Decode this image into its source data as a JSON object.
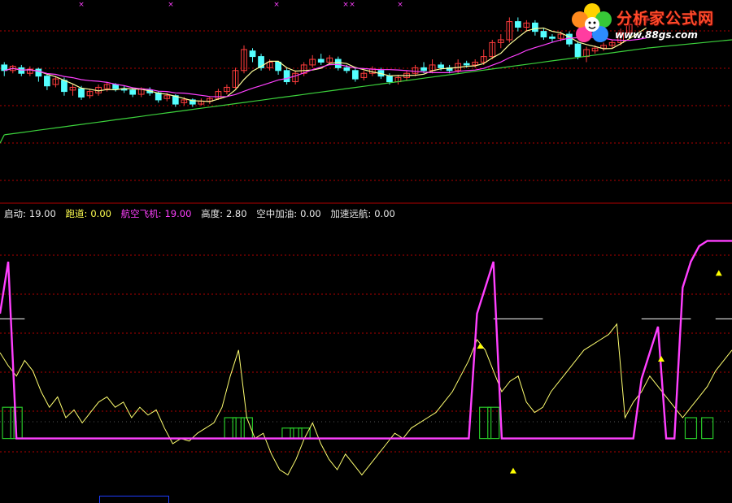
{
  "logo": {
    "title": "分析家公式网",
    "url": "www.88gs.com"
  },
  "indicator_readout": [
    {
      "label": "启动:",
      "value": "19.00",
      "label_color": "#e8e8e8",
      "value_color": "#e8e8e8"
    },
    {
      "label": "跑道:",
      "value": "0.00",
      "label_color": "#ffff50",
      "value_color": "#ffff50"
    },
    {
      "label": "航空飞机:",
      "value": "19.00",
      "label_color": "#ff40ff",
      "value_color": "#ff40ff"
    },
    {
      "label": "高度:",
      "value": "2.80",
      "label_color": "#e8e8e8",
      "value_color": "#e8e8e8"
    },
    {
      "label": "空中加油:",
      "value": "0.00",
      "label_color": "#e8e8e8",
      "value_color": "#e8e8e8"
    },
    {
      "label": "加速远航:",
      "value": "0.00",
      "label_color": "#e8e8e8",
      "value_color": "#e8e8e8"
    }
  ],
  "colors": {
    "background": "#000000",
    "grid": "#b00000",
    "up_candle": "#ff3c3c",
    "down_candle": "#54ffff",
    "ma_short": "#ffff9a",
    "ma_mid": "#ff40ff",
    "ma_long": "#3cd23c",
    "oscillator": "#ffff70",
    "runway": "#ff40ff",
    "bars": "#28c828",
    "marker": "#ffff00",
    "white_level": "#ffffff",
    "top_marks": "#ff40ff"
  },
  "chart_data": [
    {
      "type": "candlestick",
      "panel": "price",
      "y_range": [
        0,
        100
      ],
      "grid": true,
      "candles": [
        {
          "o": 64,
          "c": 60,
          "h": 66,
          "l": 56
        },
        {
          "o": 60,
          "c": 63,
          "h": 64,
          "l": 58
        },
        {
          "o": 62,
          "c": 58,
          "h": 64,
          "l": 56
        },
        {
          "o": 58,
          "c": 61,
          "h": 63,
          "l": 56
        },
        {
          "o": 61,
          "c": 56,
          "h": 62,
          "l": 52
        },
        {
          "o": 56,
          "c": 49,
          "h": 57,
          "l": 46
        },
        {
          "o": 50,
          "c": 54,
          "h": 56,
          "l": 48
        },
        {
          "o": 53,
          "c": 45,
          "h": 55,
          "l": 42
        },
        {
          "o": 46,
          "c": 48,
          "h": 50,
          "l": 42
        },
        {
          "o": 47,
          "c": 41,
          "h": 49,
          "l": 39
        },
        {
          "o": 42,
          "c": 45,
          "h": 47,
          "l": 40
        },
        {
          "o": 44,
          "c": 48,
          "h": 50,
          "l": 42
        },
        {
          "o": 47,
          "c": 50,
          "h": 52,
          "l": 45
        },
        {
          "o": 50,
          "c": 47,
          "h": 51,
          "l": 45
        },
        {
          "o": 47,
          "c": 46,
          "h": 49,
          "l": 44
        },
        {
          "o": 46,
          "c": 43,
          "h": 48,
          "l": 41
        },
        {
          "o": 43,
          "c": 47,
          "h": 48,
          "l": 41
        },
        {
          "o": 46,
          "c": 44,
          "h": 48,
          "l": 42
        },
        {
          "o": 44,
          "c": 39,
          "h": 45,
          "l": 37
        },
        {
          "o": 40,
          "c": 42,
          "h": 44,
          "l": 38
        },
        {
          "o": 42,
          "c": 36,
          "h": 43,
          "l": 34
        },
        {
          "o": 37,
          "c": 39,
          "h": 41,
          "l": 35
        },
        {
          "o": 39,
          "c": 36,
          "h": 40,
          "l": 34
        },
        {
          "o": 36,
          "c": 38,
          "h": 40,
          "l": 35
        },
        {
          "o": 38,
          "c": 40,
          "h": 41,
          "l": 36
        },
        {
          "o": 40,
          "c": 45,
          "h": 47,
          "l": 39
        },
        {
          "o": 45,
          "c": 48,
          "h": 50,
          "l": 43
        },
        {
          "o": 48,
          "c": 60,
          "h": 62,
          "l": 47
        },
        {
          "o": 60,
          "c": 75,
          "h": 78,
          "l": 58
        },
        {
          "o": 74,
          "c": 70,
          "h": 76,
          "l": 66
        },
        {
          "o": 70,
          "c": 62,
          "h": 72,
          "l": 60
        },
        {
          "o": 62,
          "c": 66,
          "h": 68,
          "l": 60
        },
        {
          "o": 66,
          "c": 60,
          "h": 67,
          "l": 57
        },
        {
          "o": 60,
          "c": 52,
          "h": 62,
          "l": 50
        },
        {
          "o": 52,
          "c": 58,
          "h": 60,
          "l": 50
        },
        {
          "o": 58,
          "c": 64,
          "h": 66,
          "l": 56
        },
        {
          "o": 64,
          "c": 68,
          "h": 71,
          "l": 62
        },
        {
          "o": 68,
          "c": 66,
          "h": 72,
          "l": 64
        },
        {
          "o": 66,
          "c": 69,
          "h": 71,
          "l": 64
        },
        {
          "o": 68,
          "c": 62,
          "h": 70,
          "l": 60
        },
        {
          "o": 62,
          "c": 60,
          "h": 64,
          "l": 58
        },
        {
          "o": 60,
          "c": 54,
          "h": 62,
          "l": 52
        },
        {
          "o": 55,
          "c": 58,
          "h": 60,
          "l": 53
        },
        {
          "o": 58,
          "c": 61,
          "h": 63,
          "l": 56
        },
        {
          "o": 60,
          "c": 56,
          "h": 62,
          "l": 54
        },
        {
          "o": 56,
          "c": 52,
          "h": 58,
          "l": 50
        },
        {
          "o": 52,
          "c": 55,
          "h": 57,
          "l": 50
        },
        {
          "o": 55,
          "c": 58,
          "h": 60,
          "l": 53
        },
        {
          "o": 58,
          "c": 62,
          "h": 64,
          "l": 56
        },
        {
          "o": 62,
          "c": 60,
          "h": 66,
          "l": 58
        },
        {
          "o": 60,
          "c": 64,
          "h": 68,
          "l": 58
        },
        {
          "o": 64,
          "c": 62,
          "h": 66,
          "l": 60
        },
        {
          "o": 62,
          "c": 60,
          "h": 64,
          "l": 58
        },
        {
          "o": 60,
          "c": 65,
          "h": 68,
          "l": 58
        },
        {
          "o": 65,
          "c": 64,
          "h": 67,
          "l": 62
        },
        {
          "o": 64,
          "c": 66,
          "h": 68,
          "l": 62
        },
        {
          "o": 66,
          "c": 70,
          "h": 75,
          "l": 64
        },
        {
          "o": 70,
          "c": 80,
          "h": 82,
          "l": 68
        },
        {
          "o": 80,
          "c": 82,
          "h": 86,
          "l": 76
        },
        {
          "o": 82,
          "c": 95,
          "h": 98,
          "l": 80
        },
        {
          "o": 95,
          "c": 91,
          "h": 98,
          "l": 88
        },
        {
          "o": 91,
          "c": 94,
          "h": 96,
          "l": 88
        },
        {
          "o": 94,
          "c": 88,
          "h": 96,
          "l": 85
        },
        {
          "o": 88,
          "c": 84,
          "h": 90,
          "l": 82
        },
        {
          "o": 84,
          "c": 83,
          "h": 86,
          "l": 80
        },
        {
          "o": 83,
          "c": 86,
          "h": 88,
          "l": 81
        },
        {
          "o": 86,
          "c": 79,
          "h": 88,
          "l": 77
        },
        {
          "o": 79,
          "c": 70,
          "h": 81,
          "l": 68
        },
        {
          "o": 70,
          "c": 75,
          "h": 77,
          "l": 66
        },
        {
          "o": 74,
          "c": 76,
          "h": 78,
          "l": 72
        },
        {
          "o": 76,
          "c": 78,
          "h": 80,
          "l": 74
        },
        {
          "o": 78,
          "c": 80,
          "h": 82,
          "l": 76
        },
        {
          "o": 80,
          "c": 87,
          "h": 90,
          "l": 78
        },
        {
          "o": 87,
          "c": 93,
          "h": 96,
          "l": 85
        },
        {
          "o": 93,
          "c": 96,
          "h": 98,
          "l": 91
        },
        {
          "o": 96,
          "c": 97,
          "h": 98,
          "l": 94
        }
      ],
      "lines": [
        {
          "name": "",
          "color_key": "ma_short"
        },
        {
          "name": "",
          "color_key": "ma_mid"
        },
        {
          "name": "",
          "color_key": "ma_long"
        }
      ]
    },
    {
      "type": "line",
      "panel": "indicator",
      "y_range": [
        0,
        100
      ],
      "grid": true,
      "x": [
        0,
        1,
        2,
        3,
        4,
        5,
        6,
        7,
        8,
        9,
        10,
        11,
        12,
        13,
        14,
        15,
        16,
        17,
        18,
        19,
        20,
        21,
        22,
        23,
        24,
        25,
        26,
        27,
        28,
        29,
        30,
        31,
        32,
        33,
        34,
        35,
        36,
        37,
        38,
        39,
        40,
        41,
        42,
        43,
        44,
        45,
        46,
        47,
        48,
        49,
        50,
        51,
        52,
        53,
        54,
        55,
        56,
        57,
        58,
        59,
        60,
        61,
        62,
        63,
        64,
        65,
        66,
        67,
        68,
        69,
        70,
        71,
        72,
        73,
        74,
        75,
        76,
        77,
        78,
        79,
        80,
        81,
        82,
        83,
        84,
        85,
        86,
        87,
        88,
        89
      ],
      "series": [
        {
          "name": "",
          "color_key": "oscillator",
          "values": [
            55,
            50,
            46,
            52,
            48,
            40,
            34,
            38,
            30,
            33,
            28,
            32,
            36,
            38,
            34,
            36,
            30,
            34,
            31,
            33,
            26,
            20,
            22,
            21,
            24,
            26,
            28,
            34,
            46,
            56,
            30,
            22,
            24,
            16,
            10,
            8,
            14,
            22,
            28,
            20,
            14,
            10,
            16,
            12,
            8,
            12,
            16,
            20,
            24,
            22,
            26,
            28,
            30,
            32,
            36,
            40,
            46,
            52,
            60,
            56,
            48,
            40,
            44,
            46,
            36,
            32,
            34,
            40,
            44,
            48,
            52,
            56,
            58,
            60,
            62,
            66,
            30,
            36,
            40,
            46,
            42,
            38,
            34,
            30,
            34,
            38,
            42,
            48,
            52,
            56
          ]
        },
        {
          "name": "",
          "color_key": "runway",
          "values": [
            70,
            90,
            22,
            22,
            22,
            22,
            22,
            22,
            22,
            22,
            22,
            22,
            22,
            22,
            22,
            22,
            22,
            22,
            22,
            22,
            22,
            22,
            22,
            22,
            22,
            22,
            22,
            22,
            22,
            22,
            22,
            22,
            22,
            22,
            22,
            22,
            22,
            22,
            22,
            22,
            22,
            22,
            22,
            22,
            22,
            22,
            22,
            22,
            22,
            22,
            22,
            22,
            22,
            22,
            22,
            22,
            22,
            22,
            70,
            80,
            90,
            22,
            22,
            22,
            22,
            22,
            22,
            22,
            22,
            22,
            22,
            22,
            22,
            22,
            22,
            22,
            22,
            22,
            45,
            55,
            65,
            22,
            22,
            80,
            90,
            96,
            98,
            98,
            98,
            98
          ]
        }
      ],
      "bars": [
        {
          "x": 1,
          "value": 12
        },
        {
          "x": 2,
          "value": 12
        },
        {
          "x": 28,
          "value": 8
        },
        {
          "x": 29,
          "value": 8
        },
        {
          "x": 30,
          "value": 8
        },
        {
          "x": 35,
          "value": 4
        },
        {
          "x": 36,
          "value": 4
        },
        {
          "x": 37,
          "value": 4
        },
        {
          "x": 59,
          "value": 12
        },
        {
          "x": 60,
          "value": 12
        },
        {
          "x": 84,
          "value": 8
        },
        {
          "x": 86,
          "value": 8
        }
      ],
      "markers": [
        58,
        62,
        80,
        87
      ],
      "levels": [
        {
          "value": 68,
          "x_from": 0,
          "x_to": 3
        },
        {
          "value": 68,
          "x_from": 60,
          "x_to": 66
        },
        {
          "value": 68,
          "x_from": 78,
          "x_to": 84
        },
        {
          "value": 68,
          "x_from": 87,
          "x_to": 89
        }
      ]
    }
  ]
}
